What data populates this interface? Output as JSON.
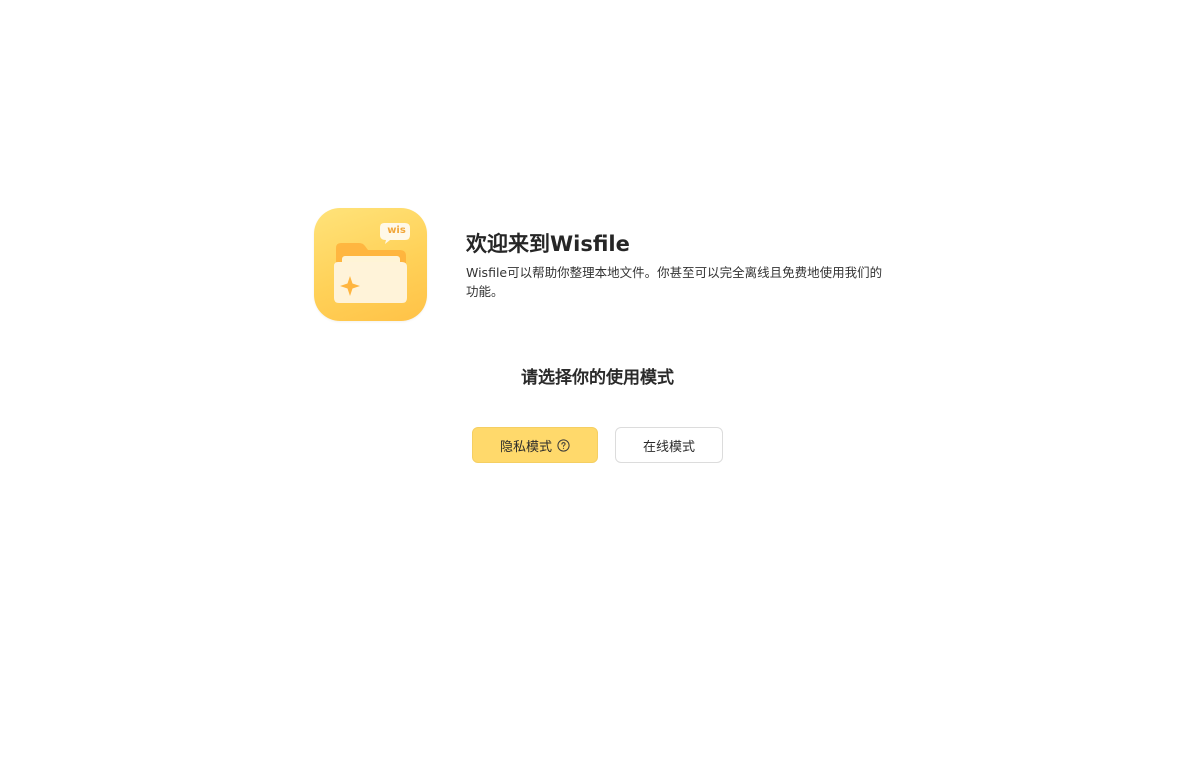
{
  "app": {
    "logo_icon": "folder-sparkle-icon",
    "logo_badge": "wis",
    "brand_colors": {
      "logo_gradient_start": "#ffe37a",
      "logo_gradient_end": "#ffc247",
      "primary_button": "#ffd96b"
    }
  },
  "welcome": {
    "title": "欢迎来到Wisfile",
    "description": "Wisfile可以帮助你整理本地文件。你甚至可以完全离线且免费地使用我们的功能。"
  },
  "mode_select": {
    "heading": "请选择你的使用模式",
    "private_label": "隐私模式",
    "private_help_icon": "question-circle-icon",
    "online_label": "在线模式"
  }
}
